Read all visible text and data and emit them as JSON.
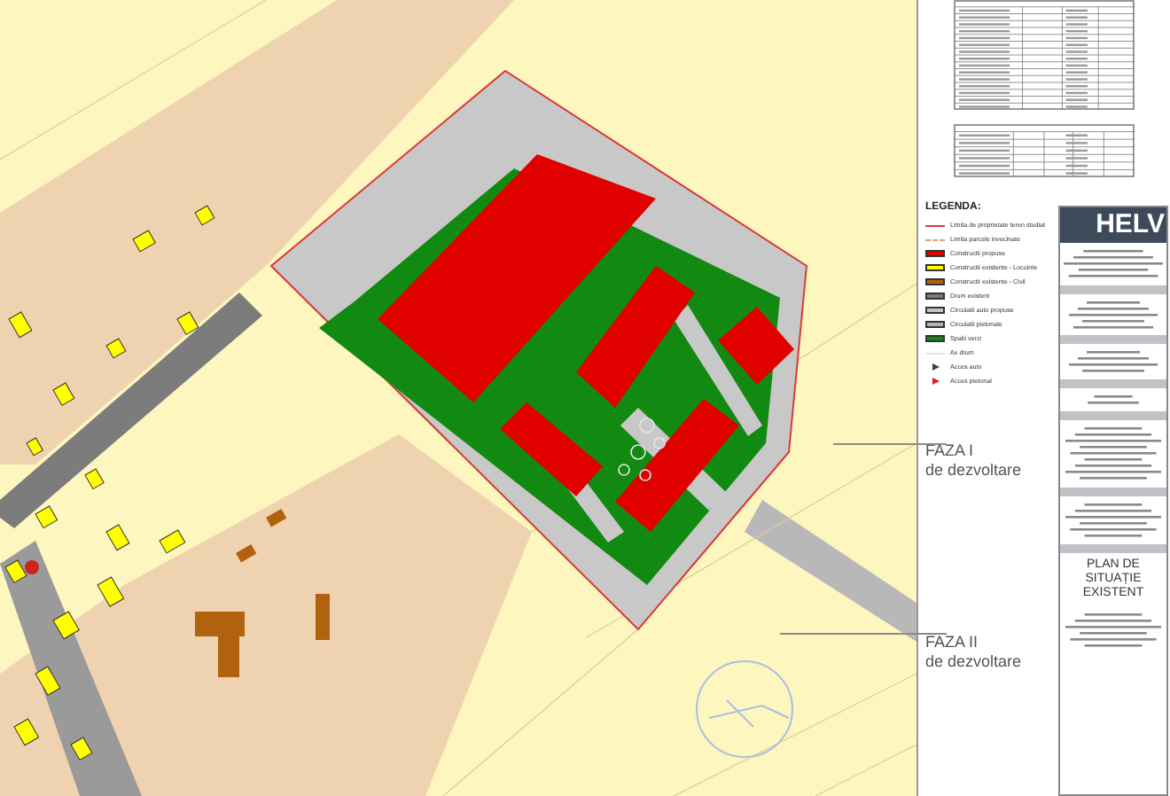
{
  "legend": {
    "title": "LEGENDA:",
    "items": [
      {
        "kind": "line",
        "color": "#d83a3a",
        "label": "Limita de proprietate teren studiat"
      },
      {
        "kind": "dash",
        "color": "#f0a070",
        "label": "Limita parcele invecinate"
      },
      {
        "kind": "swatch",
        "color": "#e00000",
        "label": "Constructii propuse"
      },
      {
        "kind": "swatch",
        "color": "#ffff00",
        "label": "Constructii existente - Locuinte"
      },
      {
        "kind": "swatch",
        "color": "#b0620f",
        "label": "Constructii existente - Civil"
      },
      {
        "kind": "swatch",
        "color": "#7c7c7c",
        "label": "Drum existent"
      },
      {
        "kind": "swatch",
        "color": "#c4c4c4",
        "label": "Circulatii auto propuse"
      },
      {
        "kind": "swatch",
        "color": "#b4b4b4",
        "label": "Circulatii pietonale"
      },
      {
        "kind": "swatch",
        "color": "#128a12",
        "label": "Spatii verzi"
      },
      {
        "kind": "axis",
        "color": "#e4e4e4",
        "label": "Ax drum"
      },
      {
        "kind": "arrow",
        "color": "#404040",
        "label": "Acces auto"
      },
      {
        "kind": "arrow",
        "color": "#e02020",
        "label": "Acces pietonal"
      }
    ]
  },
  "phases": [
    {
      "title": "FAZA I",
      "subtitle": "de dezvoltare"
    },
    {
      "title": "FAZA II",
      "subtitle": "de dezvoltare"
    }
  ],
  "title_block": {
    "logo": "HELV",
    "drawing_title": "PLAN DE SITUAȚIE EXISTENT"
  }
}
